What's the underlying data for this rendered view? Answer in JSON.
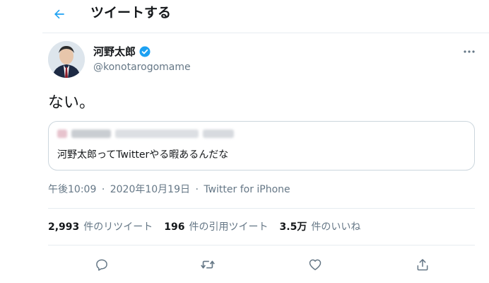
{
  "header": {
    "title": "ツイートする",
    "back_icon": "arrow-left-icon"
  },
  "tweet": {
    "user": {
      "name": "河野太郎",
      "handle": "@konotarogomame",
      "verified": true
    },
    "text": "ない。",
    "quote": {
      "text": "河野太郎ってTwitterやる暇あるんだな"
    },
    "time": "午後10:09",
    "date": "2020年10月19日",
    "separator": "·",
    "source": "Twitter for iPhone"
  },
  "stats": {
    "retweets": {
      "count": "2,993",
      "label": "件のリツイート"
    },
    "quotes": {
      "count": "196",
      "label": "件の引用ツイート"
    },
    "likes": {
      "count": "3.5万",
      "label": "件のいいね"
    }
  },
  "actions": [
    "reply-icon",
    "retweet-icon",
    "like-icon",
    "share-icon"
  ],
  "colors": {
    "accent": "#1da1f2",
    "text": "#14171a",
    "secondary": "#657786",
    "border": "#e6ecf0"
  }
}
